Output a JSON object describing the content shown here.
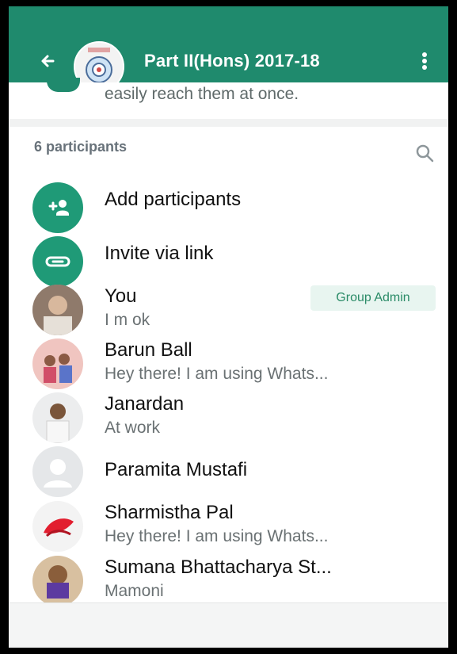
{
  "header": {
    "title": "Part II(Hons) 2017-18"
  },
  "description": {
    "text": "easily reach them at once."
  },
  "participants": {
    "count_label": "6 participants"
  },
  "actions": [
    {
      "label": "Add participants"
    },
    {
      "label": "Invite via link"
    }
  ],
  "members": [
    {
      "name": "You",
      "status": "I m ok",
      "badge": "Group Admin"
    },
    {
      "name": "Barun Ball",
      "status": "Hey there! I am using Whats..."
    },
    {
      "name": "Janardan",
      "status": "At work"
    },
    {
      "name": "Paramita Mustafi",
      "status": ""
    },
    {
      "name": "Sharmistha Pal",
      "status": "Hey there! I am using Whats..."
    },
    {
      "name": "Sumana Bhattacharya St...",
      "status": "Mamoni"
    }
  ],
  "colors": {
    "header_bg": "#1f8a6d",
    "accent_green": "#1f9a77",
    "badge_bg": "#e8f5f0",
    "badge_text": "#2a8b67"
  },
  "icons": {
    "back": "back-arrow-icon",
    "kebab": "more-vert-icon",
    "search": "search-icon",
    "add_participants": "add-person-icon",
    "invite_link": "link-icon",
    "default_avatar": "default-avatar-icon"
  }
}
